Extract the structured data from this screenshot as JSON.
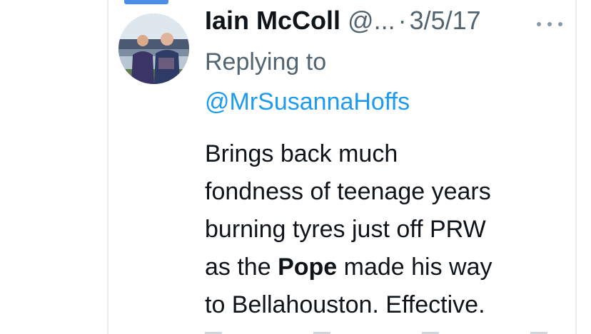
{
  "tweet": {
    "author_name": "Iain McColl",
    "author_handle": "@...",
    "separator": "·",
    "date": "3/5/17",
    "replying_label": "Replying to",
    "replying_to": "@MrSusannaHoffs",
    "text_lines": [
      {
        "before": "Brings back much",
        "bold": "",
        "after": ""
      },
      {
        "before": "fondness of teenage years",
        "bold": "",
        "after": ""
      },
      {
        "before": "burning tyres just off PRW",
        "bold": "",
        "after": ""
      },
      {
        "before": "as the ",
        "bold": "Pope",
        "after": " made his way"
      },
      {
        "before": "to Bellahouston. Effective.",
        "bold": "",
        "after": ""
      }
    ]
  },
  "icons": {
    "more": "more-horizontal-icon"
  },
  "colors": {
    "name": "#0f1419",
    "secondary": "#536471",
    "link": "#1d9bf0",
    "accent": "#4a8ee8"
  }
}
